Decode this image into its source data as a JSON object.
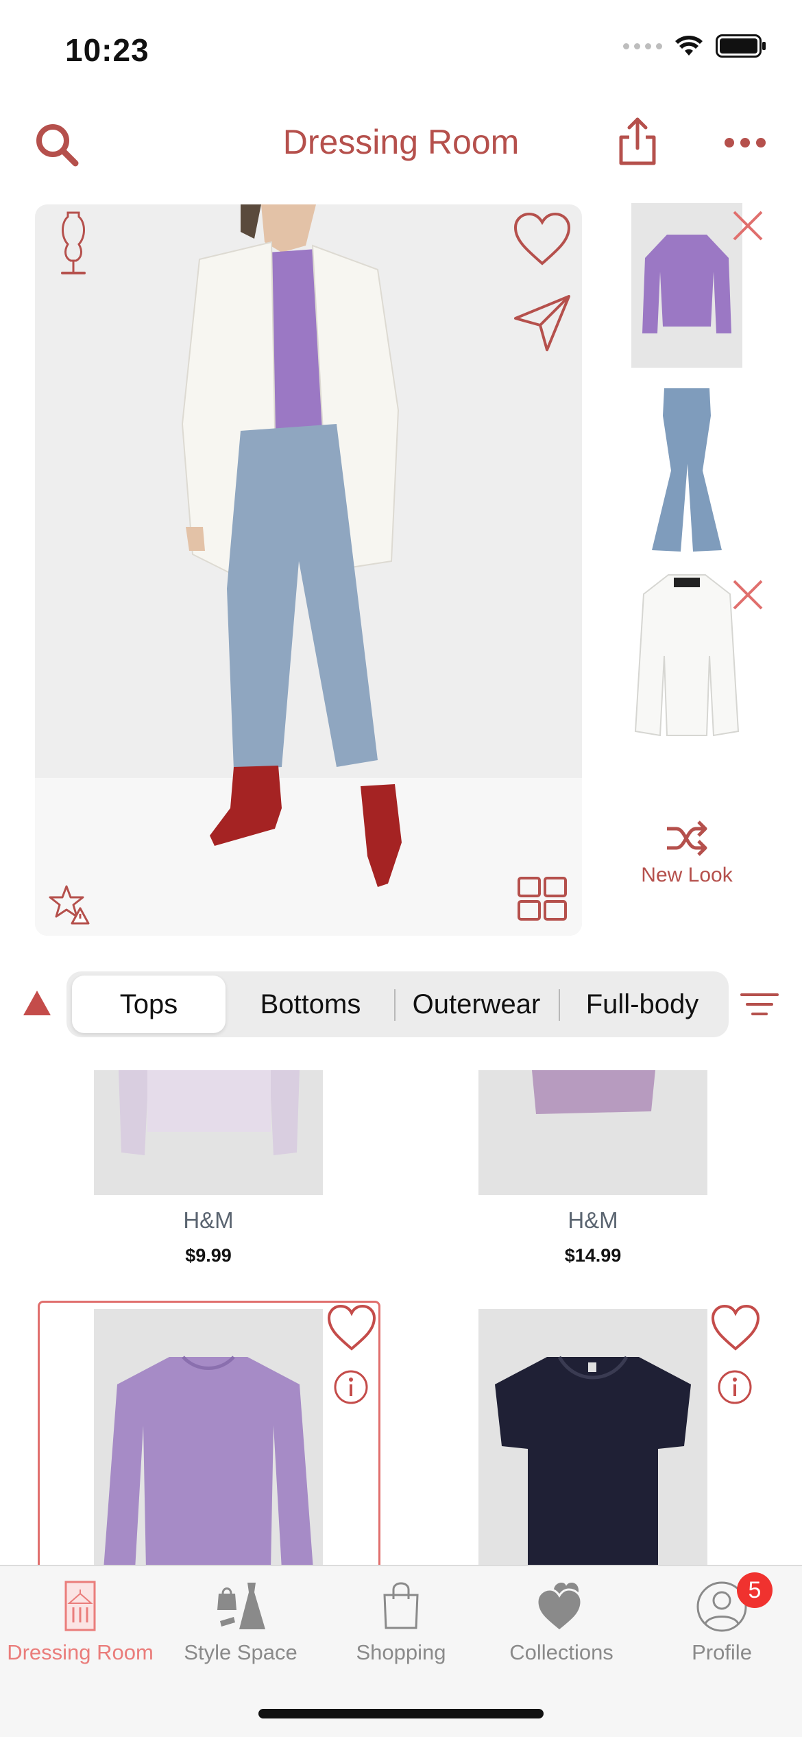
{
  "status_bar": {
    "time": "10:23"
  },
  "header": {
    "title": "Dressing Room"
  },
  "try_on": {
    "new_look_label": "New Look"
  },
  "categories": [
    {
      "label": "Tops",
      "active": true
    },
    {
      "label": "Bottoms",
      "active": false
    },
    {
      "label": "Outerwear",
      "active": false
    },
    {
      "label": "Full-body",
      "active": false
    }
  ],
  "products": [
    {
      "brand": "H&M",
      "price": "$9.99"
    },
    {
      "brand": "H&M",
      "price": "$14.99"
    },
    {
      "brand": "",
      "price": ""
    },
    {
      "brand": "",
      "price": ""
    }
  ],
  "tabbar": {
    "items": [
      {
        "label": "Dressing Room",
        "icon": "dressing-room-icon",
        "active": true
      },
      {
        "label": "Style Space",
        "icon": "style-space-icon",
        "active": false
      },
      {
        "label": "Shopping",
        "icon": "shopping-bag-icon",
        "active": false
      },
      {
        "label": "Collections",
        "icon": "collections-hearts-icon",
        "active": false
      },
      {
        "label": "Profile",
        "icon": "profile-icon",
        "active": false
      }
    ],
    "profile_badge": "5"
  },
  "colors": {
    "accent": "#b5504c",
    "accent_light": "#e06f6d",
    "tab_active": "#ea7d7b",
    "badge": "#f0322f",
    "top_purple": "#9b78c4",
    "jeans_blue": "#8fa6c0",
    "tee_navy": "#1f2035"
  }
}
